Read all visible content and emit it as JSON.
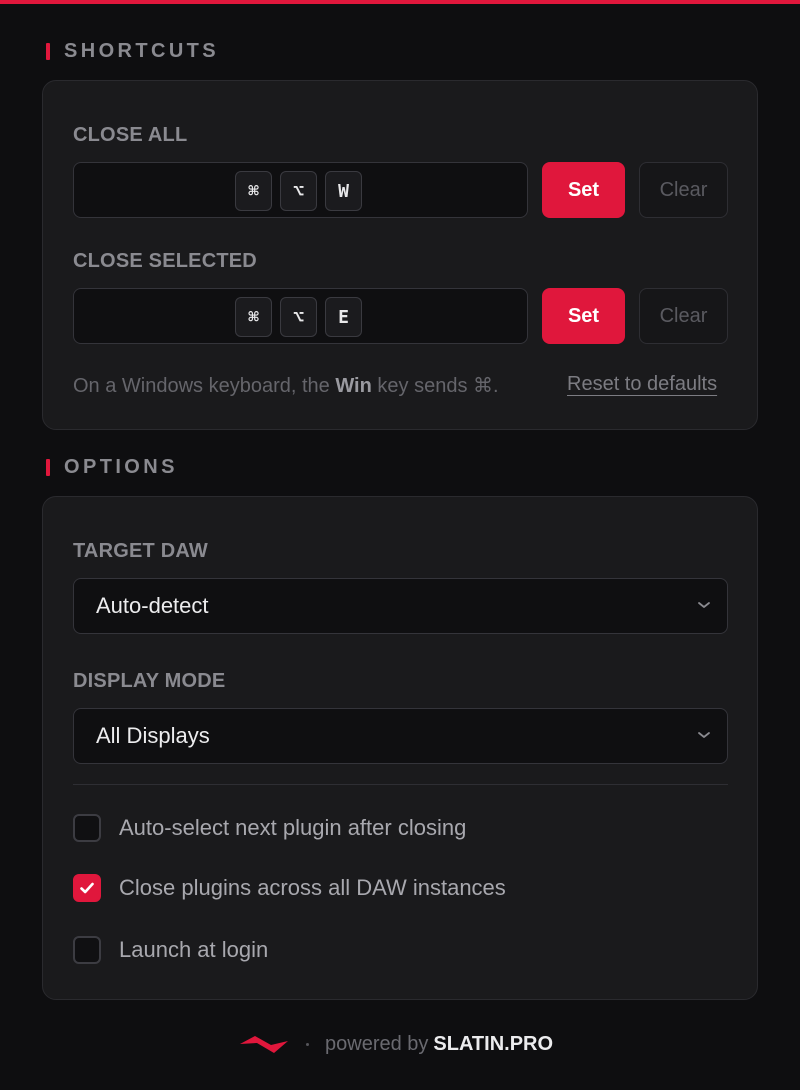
{
  "shortcuts": {
    "title": "SHORTCUTS",
    "close_all": {
      "label": "CLOSE ALL",
      "keys": [
        "⌘",
        "⌥",
        "W"
      ],
      "set_label": "Set",
      "clear_label": "Clear"
    },
    "close_selected": {
      "label": "CLOSE SELECTED",
      "keys": [
        "⌘",
        "⌥",
        "E"
      ],
      "set_label": "Set",
      "clear_label": "Clear"
    },
    "note_prefix": "On a Windows keyboard, the ",
    "note_key": "Win",
    "note_suffix": " key sends ⌘.",
    "reset_label": "Reset to defaults"
  },
  "options": {
    "title": "OPTIONS",
    "target_daw": {
      "label": "TARGET DAW",
      "value": "Auto-detect"
    },
    "display_mode": {
      "label": "DISPLAY MODE",
      "value": "All Displays"
    },
    "checkboxes": [
      {
        "label": "Auto-select next plugin after closing",
        "checked": false
      },
      {
        "label": "Close plugins across all DAW instances",
        "checked": true
      },
      {
        "label": "Launch at login",
        "checked": false
      }
    ]
  },
  "footer": {
    "powered_by": "powered by",
    "brand": "SLATIN.PRO"
  },
  "colors": {
    "accent": "#e0173c",
    "background": "#0e0e10",
    "card": "#1a1a1c"
  }
}
